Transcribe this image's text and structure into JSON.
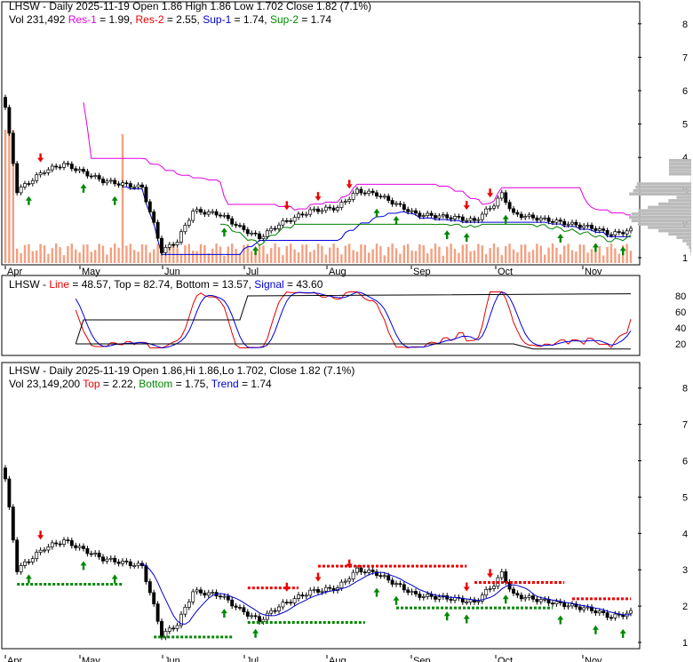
{
  "panel1": {
    "title": "LHSW - Daily 2025-11-19 Open 1.86  High 1.86  Low 1.702  Close 1.82 (7.1%)",
    "vol": "Vol 231,492",
    "res1_label": "Res-1",
    "res1": " = 1.99,",
    "res2_label": "Res-2",
    "res2": " = 2.55,",
    "sup1_label": "Sup-1",
    "sup1": " = 1.74,",
    "sup2_label": "Sup-2",
    "sup2": " = 1.74"
  },
  "panel2": {
    "prefix": "LHSW - ",
    "line_label": "Line",
    "line": " = 48.57, Top = 82.74, Bottom = 13.57, ",
    "signal_label": "Signal",
    "signal": " = 43.60"
  },
  "panel3": {
    "title": "LHSW - Daily 2025-11-19 Open 1.86,Hi 1.86,Lo 1.702, Close 1.82 (7.1%)",
    "vol": "Vol 23,149,200",
    "top_label": "Top",
    "top": " = 2.22,",
    "bottom_label": "Bottom",
    "bottom": " = 1.75,",
    "trend_label": "Trend",
    "trend": " = 1.74"
  },
  "colors": {
    "res1": "#e000e0",
    "res2": "#e00000",
    "sup1": "#0000e0",
    "sup2": "#008000",
    "line": "#e00000",
    "signal": "#0000e0"
  },
  "chart_data": {
    "type": "candlestick",
    "x_ticks": [
      "Apr",
      "May",
      "Jun",
      "Jul",
      "Aug",
      "Sep",
      "Oct",
      "Nov"
    ],
    "price_ticks": [
      1,
      2,
      3,
      4,
      5,
      6,
      7,
      8
    ],
    "osc_ticks": [
      20,
      40,
      60,
      80
    ],
    "keypoints": [
      [
        0,
        5.5
      ],
      [
        3,
        3.0
      ],
      [
        10,
        3.6
      ],
      [
        15,
        3.8
      ],
      [
        25,
        3.3
      ],
      [
        35,
        3.1
      ],
      [
        38,
        2.0
      ],
      [
        40,
        1.2
      ],
      [
        44,
        1.5
      ],
      [
        48,
        2.4
      ],
      [
        55,
        2.3
      ],
      [
        60,
        1.9
      ],
      [
        65,
        1.6
      ],
      [
        70,
        2.0
      ],
      [
        78,
        2.4
      ],
      [
        85,
        2.5
      ],
      [
        90,
        3.0
      ],
      [
        95,
        2.9
      ],
      [
        100,
        2.6
      ],
      [
        105,
        2.3
      ],
      [
        115,
        2.2
      ],
      [
        120,
        2.1
      ],
      [
        125,
        2.6
      ],
      [
        127,
        2.9
      ],
      [
        130,
        2.3
      ],
      [
        140,
        2.1
      ],
      [
        150,
        1.9
      ],
      [
        155,
        1.7
      ],
      [
        160,
        1.82
      ]
    ],
    "days": 161,
    "buy_arrows": [
      6,
      20,
      28,
      56,
      64,
      95,
      100,
      113,
      118,
      128,
      142,
      151,
      158
    ],
    "sell_arrows": [
      9,
      72,
      80,
      88,
      118,
      124
    ]
  }
}
